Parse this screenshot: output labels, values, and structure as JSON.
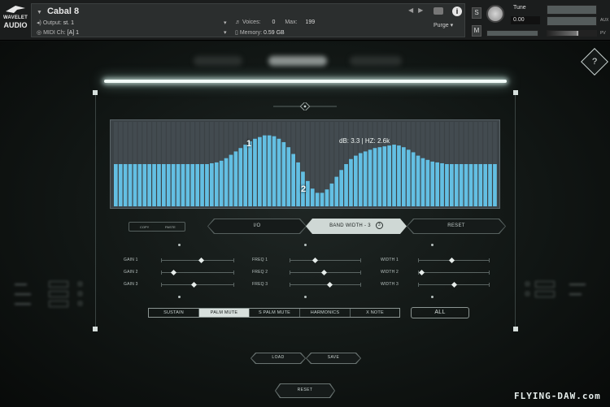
{
  "header": {
    "logo": {
      "line1": "WAVELET",
      "line2": "AUDIO"
    },
    "instrument_name": "Cabal 8",
    "output_label": "Output:",
    "output_value": "st. 1",
    "midi_label": "MIDI Ch:",
    "midi_value": "[A]  1",
    "voices_label": "Voices:",
    "voices_value": "0",
    "max_label": "Max:",
    "max_value": "199",
    "memory_label": "Memory:",
    "memory_value": "0.59 GB",
    "purge_label": "Purge",
    "solo_label": "S",
    "mute_label": "M",
    "tune_label": "Tune",
    "tune_value": "0.00",
    "aux_label": "AUX",
    "pv_label": "PV"
  },
  "main": {
    "help_label": "?",
    "eq": {
      "readout": "dB:  3.3 | HZ:  2.6k",
      "node1_label": "1",
      "node2_label": "2",
      "bar_levels": [
        0.5,
        0.5,
        0.5,
        0.5,
        0.5,
        0.5,
        0.5,
        0.5,
        0.5,
        0.5,
        0.5,
        0.5,
        0.5,
        0.5,
        0.5,
        0.5,
        0.5,
        0.5,
        0.5,
        0.5,
        0.51,
        0.52,
        0.54,
        0.57,
        0.61,
        0.65,
        0.69,
        0.73,
        0.77,
        0.8,
        0.82,
        0.84,
        0.84,
        0.83,
        0.8,
        0.76,
        0.7,
        0.62,
        0.52,
        0.41,
        0.3,
        0.21,
        0.16,
        0.16,
        0.2,
        0.27,
        0.35,
        0.43,
        0.5,
        0.56,
        0.6,
        0.63,
        0.65,
        0.67,
        0.69,
        0.7,
        0.71,
        0.72,
        0.73,
        0.72,
        0.7,
        0.67,
        0.64,
        0.6,
        0.57,
        0.55,
        0.53,
        0.52,
        0.51,
        0.5,
        0.5,
        0.5,
        0.5,
        0.5,
        0.5,
        0.5,
        0.5,
        0.5,
        0.5,
        0.5
      ]
    },
    "copy_label": "COPY",
    "paste_label": "PASTE",
    "tabs": [
      {
        "label": "I/O"
      },
      {
        "label": "BAND WIDTH - 3",
        "badge": "3"
      },
      {
        "label": "RESET"
      }
    ],
    "sliders": {
      "gain": [
        {
          "label": "GAIN 1",
          "value": 0.55
        },
        {
          "label": "GAIN 2",
          "value": 0.15
        },
        {
          "label": "GAIN 3",
          "value": 0.45
        }
      ],
      "freq": [
        {
          "label": "FREQ 1",
          "value": 0.35
        },
        {
          "label": "FREQ 2",
          "value": 0.48
        },
        {
          "label": "FREQ 3",
          "value": 0.57
        }
      ],
      "width": [
        {
          "label": "WIDTH 1",
          "value": 0.47
        },
        {
          "label": "WIDTH 2",
          "value": 0.03
        },
        {
          "label": "WIDTH 3",
          "value": 0.5
        }
      ]
    },
    "articulations": [
      {
        "label": "SUSTAIN",
        "active": false
      },
      {
        "label": "PALM MUTE",
        "active": true
      },
      {
        "label": "S PALM MUTE",
        "active": false
      },
      {
        "label": "HARMONICS",
        "active": false
      },
      {
        "label": "X NOTE",
        "active": false
      }
    ],
    "all_label": "ALL",
    "load_label": "LOAD",
    "save_label": "SAVE",
    "reset_label": "RESET"
  },
  "watermark": "FLYING-DAW.com",
  "colors": {
    "eq_bar": "#63bfe3",
    "eq_bg": "#3b4246",
    "accent": "#cfd8d5",
    "glow": "#f1faf7"
  }
}
